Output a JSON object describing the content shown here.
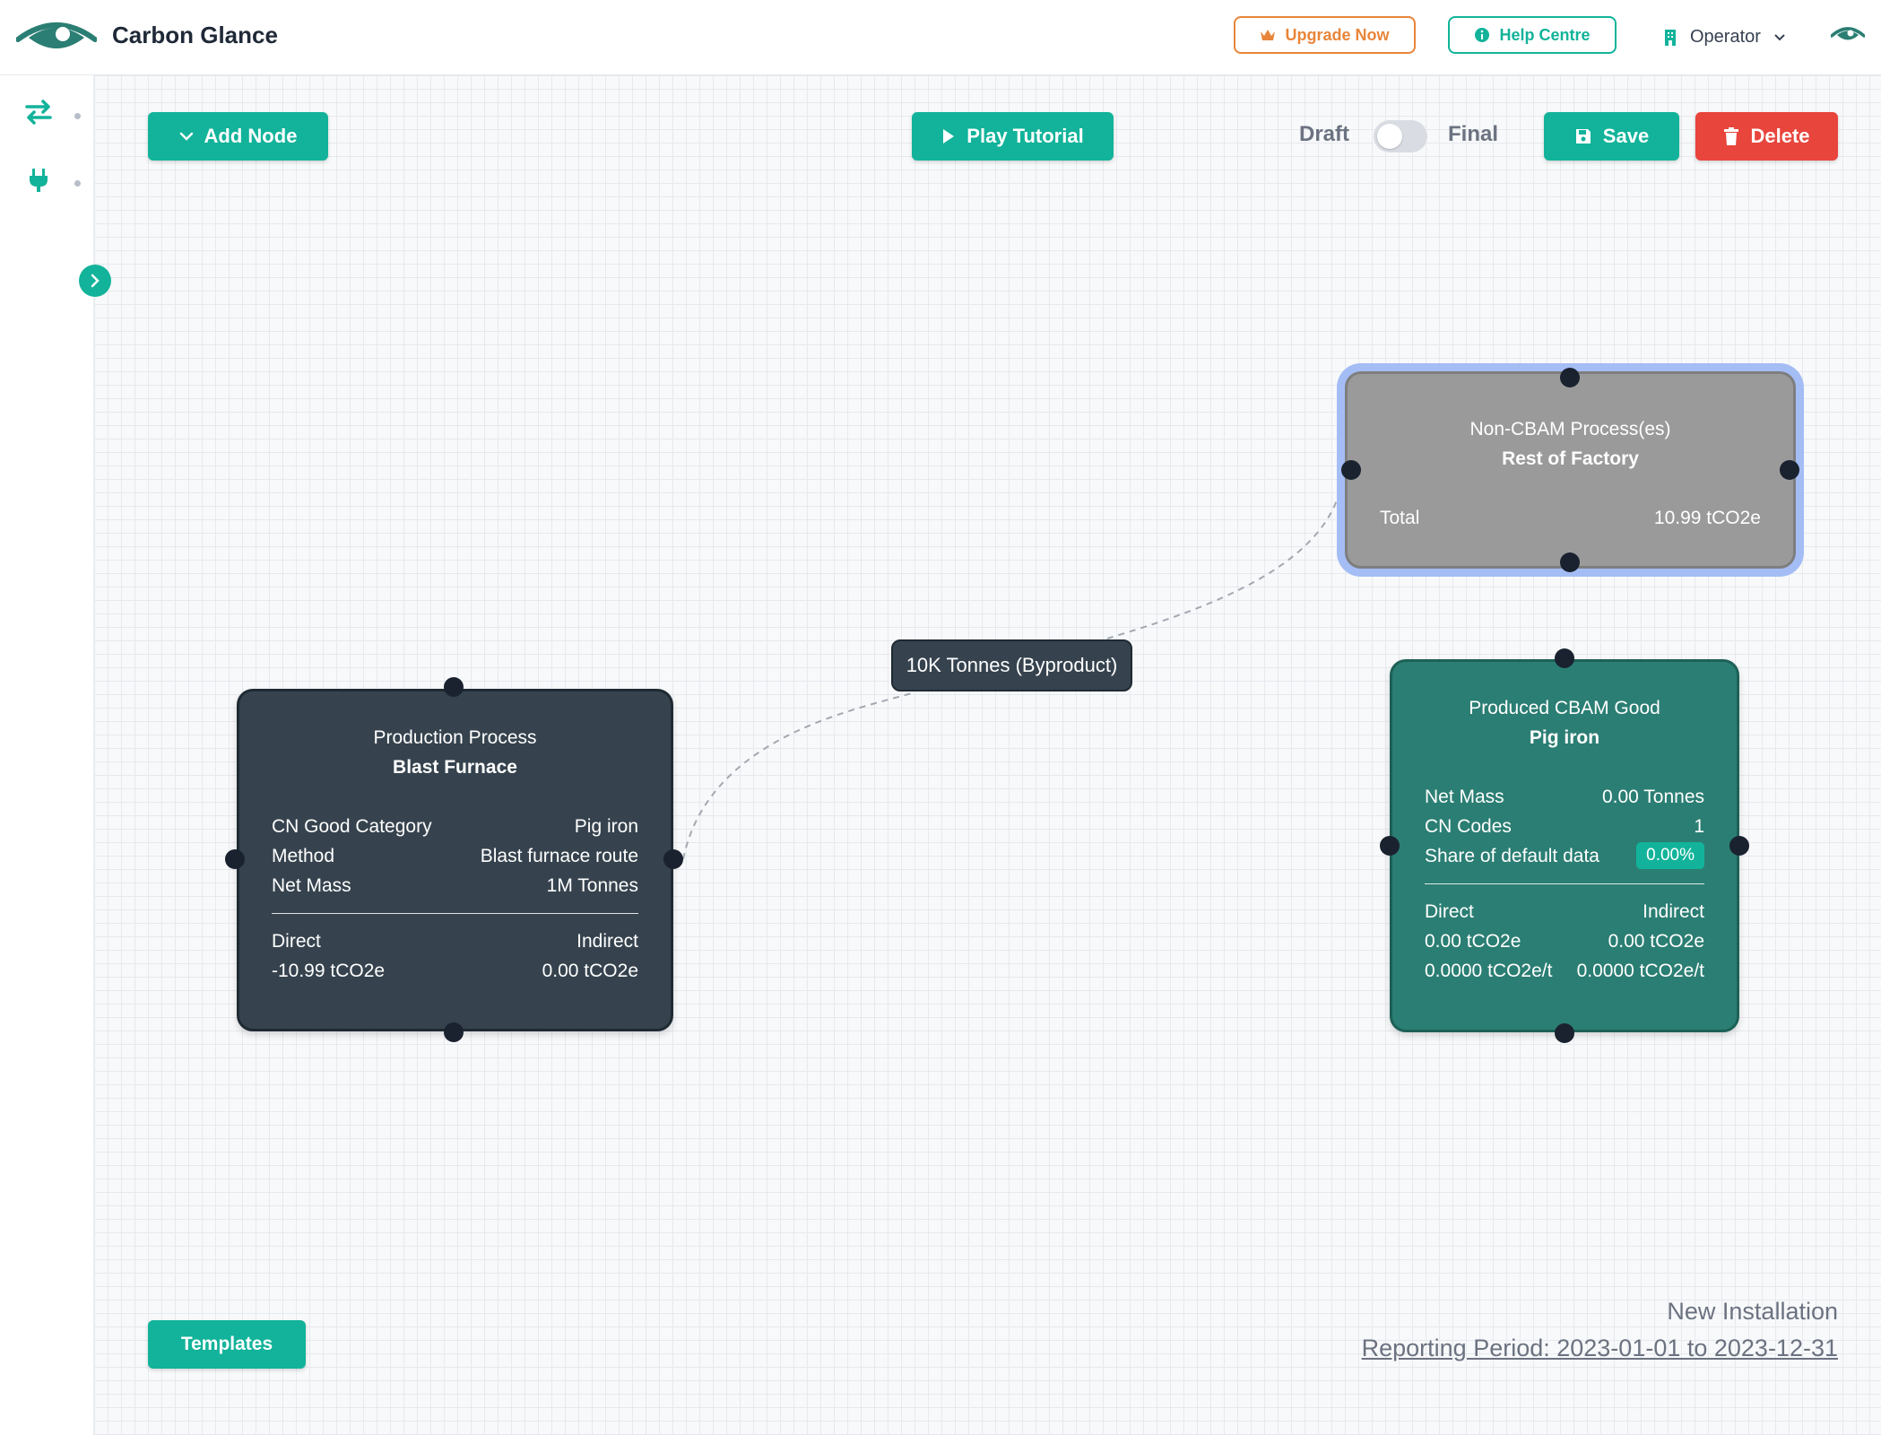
{
  "app": {
    "brand": "Carbon Glance",
    "accent_color": "#12b39a",
    "danger_color": "#e8453c",
    "warning_color": "#e8853a"
  },
  "header": {
    "upgrade_label": "Upgrade Now",
    "help_label": "Help Centre",
    "operator_label": "Operator"
  },
  "sidebar": {
    "items": [
      {
        "icon": "swap-arrows-icon"
      },
      {
        "icon": "plug-icon"
      }
    ],
    "expand_icon": "chevron-right-icon"
  },
  "toolbar": {
    "add_node_label": "Add Node",
    "play_tutorial_label": "Play Tutorial",
    "draft_label": "Draft",
    "final_label": "Final",
    "save_label": "Save",
    "delete_label": "Delete",
    "templates_label": "Templates"
  },
  "nodes": {
    "production": {
      "title": "Production Process",
      "name": "Blast Furnace",
      "rows": [
        {
          "label": "CN Good Category",
          "value": "Pig iron"
        },
        {
          "label": "Method",
          "value": "Blast furnace route"
        },
        {
          "label": "Net Mass",
          "value": "1M Tonnes"
        }
      ],
      "direct_label": "Direct",
      "indirect_label": "Indirect",
      "direct_value": "-10.99 tCO2e",
      "indirect_value": "0.00 tCO2e",
      "color": "#36434e"
    },
    "noncbam": {
      "title": "Non-CBAM Process(es)",
      "name": "Rest of Factory",
      "total_label": "Total",
      "total_value": "10.99 tCO2e",
      "color": "#9a9a9a"
    },
    "good": {
      "title": "Produced CBAM Good",
      "name": "Pig iron",
      "net_mass_label": "Net Mass",
      "net_mass_value": "0.00 Tonnes",
      "cn_codes_label": "CN Codes",
      "cn_codes_value": "1",
      "share_label": "Share of default data",
      "share_value": "0.00%",
      "direct_label": "Direct",
      "indirect_label": "Indirect",
      "direct_value": "0.00 tCO2e",
      "indirect_value": "0.00 tCO2e",
      "direct_intensity": "0.0000 tCO2e/t",
      "indirect_intensity": "0.0000 tCO2e/t",
      "color": "#2b7e73"
    }
  },
  "edge": {
    "label": "10K Tonnes (Byproduct)"
  },
  "footer": {
    "installation": "New Installation",
    "reporting_period": "Reporting Period: 2023-01-01 to 2023-12-31"
  }
}
